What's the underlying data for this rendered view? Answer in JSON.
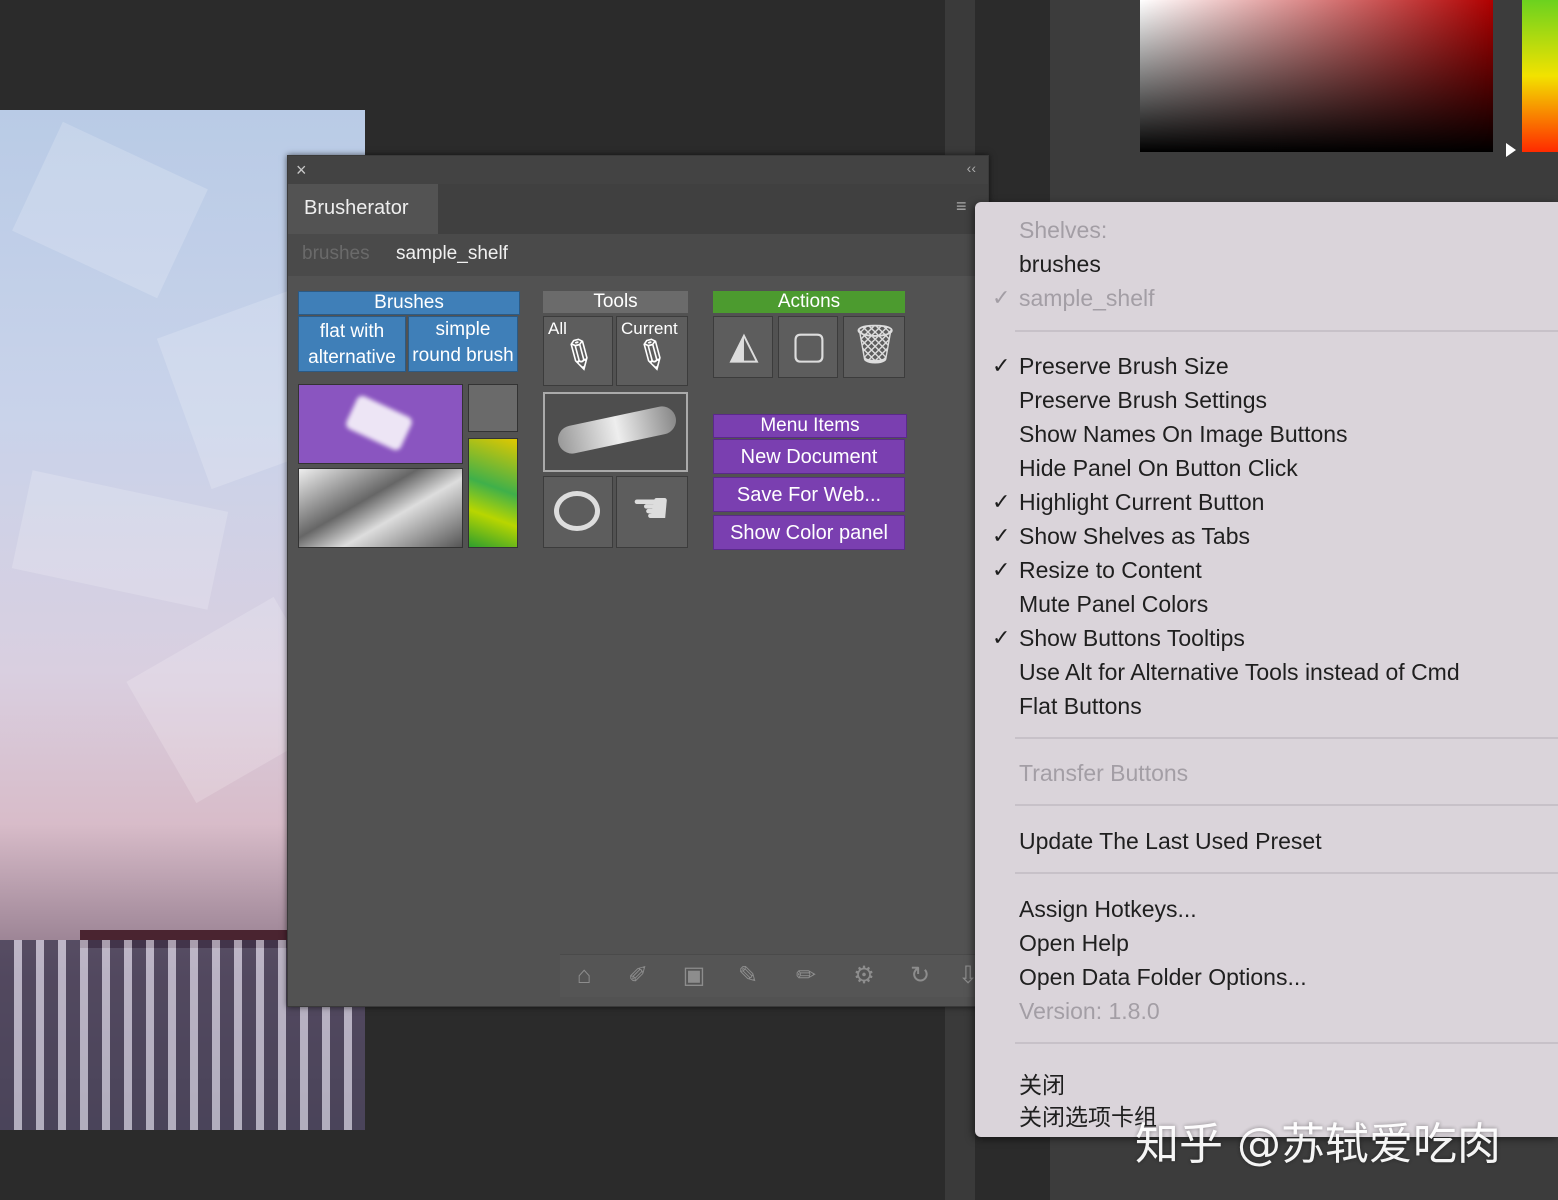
{
  "panel": {
    "close_glyph": "×",
    "collapse_glyph": "‹‹",
    "menu_glyph": "≡",
    "tab_title": "Brusherator",
    "shelves": [
      "brushes",
      "sample_shelf"
    ],
    "active_shelf": "sample_shelf",
    "groups": {
      "brushes": {
        "header": "Brushes",
        "buttons": [
          "flat with alternative",
          "simple round brush"
        ]
      },
      "tools": {
        "header": "Tools",
        "buttons": [
          "All",
          "Current"
        ]
      },
      "actions": {
        "header": "Actions"
      },
      "menu_items": {
        "header": "Menu Items",
        "buttons": [
          "New Document",
          "Save For Web...",
          "Show Color panel"
        ]
      }
    },
    "toolbar_icons": [
      "tag-icon",
      "brush-edit-icon",
      "image-icon",
      "pencil-icon",
      "eraser-icon",
      "gear-icon",
      "refresh-icon",
      "download-icon"
    ]
  },
  "context_menu": {
    "shelves_label": "Shelves:",
    "shelf_items": [
      {
        "label": "brushes",
        "checked": false,
        "disabled": false
      },
      {
        "label": "sample_shelf",
        "checked": true,
        "disabled": true
      }
    ],
    "options": [
      {
        "label": "Preserve Brush Size",
        "checked": true
      },
      {
        "label": "Preserve Brush Settings",
        "checked": false
      },
      {
        "label": "Show Names On Image Buttons",
        "checked": false
      },
      {
        "label": "Hide Panel On Button Click",
        "checked": false
      },
      {
        "label": "Highlight Current Button",
        "checked": true
      },
      {
        "label": "Show Shelves as Tabs",
        "checked": true
      },
      {
        "label": "Resize to Content",
        "checked": true
      },
      {
        "label": "Mute Panel Colors",
        "checked": false
      },
      {
        "label": "Show Buttons Tooltips",
        "checked": true
      },
      {
        "label": "Use Alt for Alternative Tools instead of Cmd",
        "checked": false
      },
      {
        "label": "Flat Buttons",
        "checked": false
      }
    ],
    "transfer_buttons": "Transfer Buttons",
    "update_preset": "Update The Last Used Preset",
    "assign_hotkeys": "Assign Hotkeys...",
    "open_help": "Open Help",
    "open_data_folder": "Open Data Folder Options...",
    "version": "Version: 1.8.0",
    "close": "关闭",
    "close_tab_group": "关闭选项卡组",
    "check_glyph": "✓"
  },
  "watermark": "知乎 @苏轼爱吃肉",
  "colors": {
    "blue": "#3f7fb8",
    "green": "#4c9b2f",
    "purple": "#7a3fb0",
    "menu_bg": "#dad4da"
  }
}
